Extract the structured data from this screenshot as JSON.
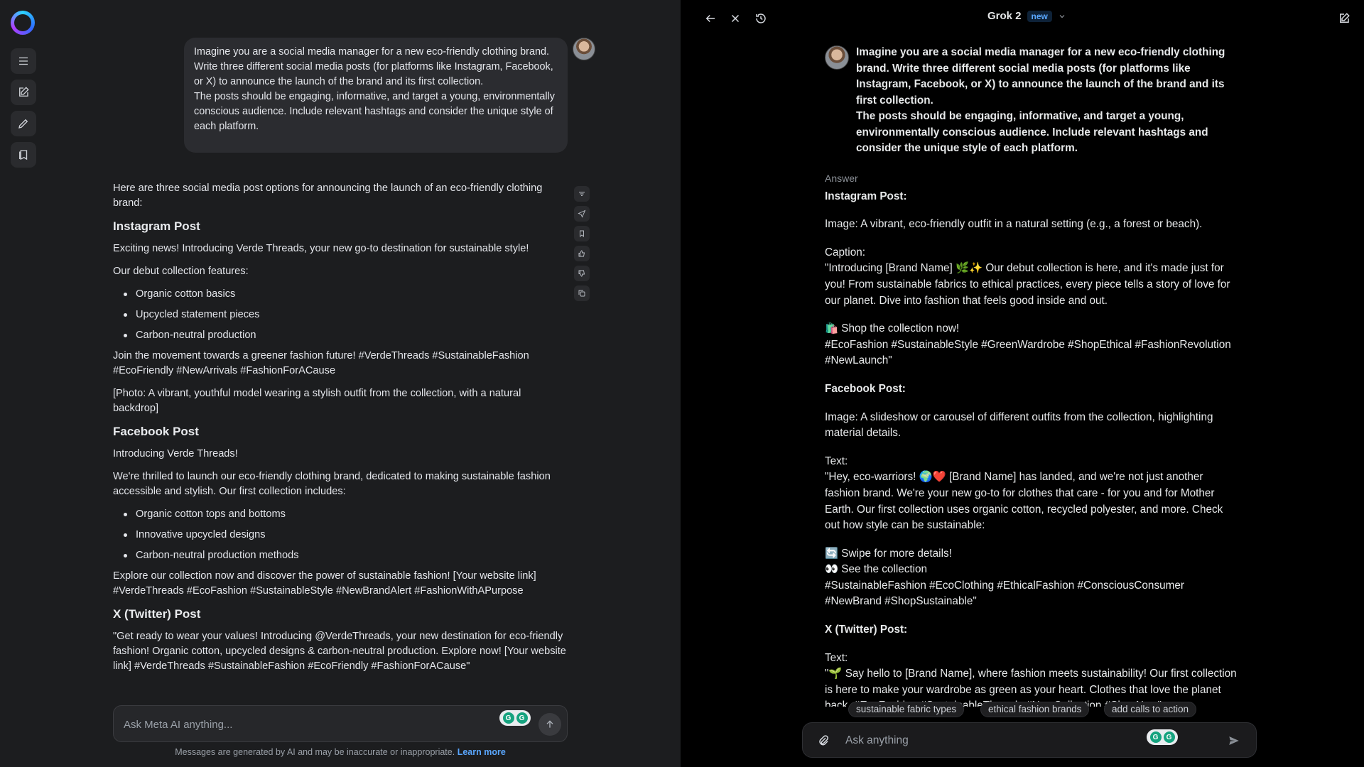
{
  "meta_ai": {
    "sidebar": {
      "logo": "meta-ai-logo",
      "buttons": [
        "menu-icon",
        "new-chat-icon",
        "pencil-icon",
        "library-icon"
      ]
    },
    "user_prompt": {
      "para1": "Imagine you are a social media manager for a new eco-friendly clothing brand. Write three different social media posts (for platforms like Instagram, Facebook, or X) to announce the launch of the brand and its first collection.",
      "para2": "The posts should be engaging, informative, and target a young, environmentally conscious audience. Include relevant hashtags and consider the unique style of each platform."
    },
    "answer": {
      "intro": "Here are three social media post options for announcing the launch of an eco-friendly clothing brand:",
      "instagram": {
        "heading": "Instagram Post",
        "p1": "Exciting news! Introducing Verde Threads, your new go-to destination for sustainable style!",
        "p2": "Our debut collection features:",
        "items": [
          "Organic cotton basics",
          "Upcycled statement pieces",
          "Carbon-neutral production"
        ],
        "p3": "Join the movement towards a greener fashion future! #VerdeThreads #SustainableFashion #EcoFriendly #NewArrivals #FashionForACause",
        "p4": "[Photo: A vibrant, youthful model wearing a stylish outfit from the collection, with a natural backdrop]"
      },
      "facebook": {
        "heading": "Facebook Post",
        "p1": "Introducing Verde Threads!",
        "p2": "We're thrilled to launch our eco-friendly clothing brand, dedicated to making sustainable fashion accessible and stylish. Our first collection includes:",
        "items": [
          "Organic cotton tops and bottoms",
          "Innovative upcycled designs",
          "Carbon-neutral production methods"
        ],
        "p3": "Explore our collection now and discover the power of sustainable fashion! [Your website link] #VerdeThreads #EcoFashion #SustainableStyle #NewBrandAlert #FashionWithAPurpose"
      },
      "twitter": {
        "heading": "X (Twitter) Post",
        "p1": "\"Get ready to wear your values! Introducing @VerdeThreads, your new destination for eco-friendly fashion! Organic cotton, upcycled designs & carbon-neutral production. Explore now! [Your website link] #VerdeThreads #SustainableFashion #EcoFriendly #FashionForACause\""
      }
    },
    "actions": [
      "filter-icon",
      "share-icon",
      "bookmark-icon",
      "thumbs-up-icon",
      "thumbs-down-icon",
      "copy-icon"
    ],
    "composer": {
      "placeholder": "Ask Meta AI anything...",
      "grammarly_icon": "grammarly-icon",
      "send_icon": "arrow-up-icon"
    },
    "disclaimer": {
      "text": "Messages are generated by AI and may be inaccurate or inappropriate.",
      "link": "Learn more"
    }
  },
  "grok": {
    "header": {
      "model": "Grok 2",
      "badge": "new",
      "left_icons": [
        "back-arrow-icon",
        "close-icon",
        "history-icon"
      ],
      "right_icon": "new-chat-icon"
    },
    "prompt": {
      "para1": "Imagine you are a social media manager for a new eco-friendly clothing brand. Write three different social media posts (for platforms like Instagram, Facebook, or X) to announce the launch of the brand and its first collection.",
      "para2": "The posts should be engaging, informative, and target a young, environmentally conscious audience. Include relevant hashtags and consider the unique style of each platform."
    },
    "answer": {
      "label": "Answer",
      "ig_heading": "Instagram Post:",
      "ig_image": "Image: A vibrant, eco-friendly outfit in a natural setting (e.g., a forest or beach).",
      "ig_caption_label": "Caption:",
      "ig_caption": "\"Introducing [Brand Name] 🌿✨ Our debut collection is here, and it's made just for you! From sustainable fabrics to ethical practices, every piece tells a story of love for our planet. Dive into fashion that feels good inside and out.",
      "ig_shop": "🛍️ Shop the collection now!",
      "ig_tags": "#EcoFashion #SustainableStyle #GreenWardrobe #ShopEthical #FashionRevolution #NewLaunch\"",
      "fb_heading": "Facebook Post:",
      "fb_image": "Image: A slideshow or carousel of different outfits from the collection, highlighting material details.",
      "fb_text_label": "Text:",
      "fb_text": "\"Hey, eco-warriors! 🌍❤️ [Brand Name] has landed, and we're not just another fashion brand. We're your new go-to for clothes that care - for you and for Mother Earth. Our first collection uses organic cotton, recycled polyester, and more. Check out how style can be sustainable:",
      "fb_swipe": "🔄 Swipe for more details!",
      "fb_see": "👀 See the collection",
      "fb_tags": "#SustainableFashion #EcoClothing #EthicalFashion #ConsciousConsumer #NewBrand #ShopSustainable\"",
      "x_heading": "X (Twitter) Post:",
      "x_text_label": "Text:",
      "x_text": "\"🌱 Say hello to [Brand Name], where fashion meets sustainability! Our first collection is here to make your wardrobe as green as your heart. Clothes that love the planet back. #EcoFashion #SustainableThreads #NewCollection #ShopNow\""
    },
    "suggestions": [
      "sustainable fabric types",
      "ethical fashion brands",
      "add calls to action"
    ],
    "composer": {
      "placeholder": "Ask anything",
      "attach_icon": "paperclip-icon",
      "grammarly_icon": "grammarly-icon",
      "send_icon": "send-icon"
    }
  }
}
